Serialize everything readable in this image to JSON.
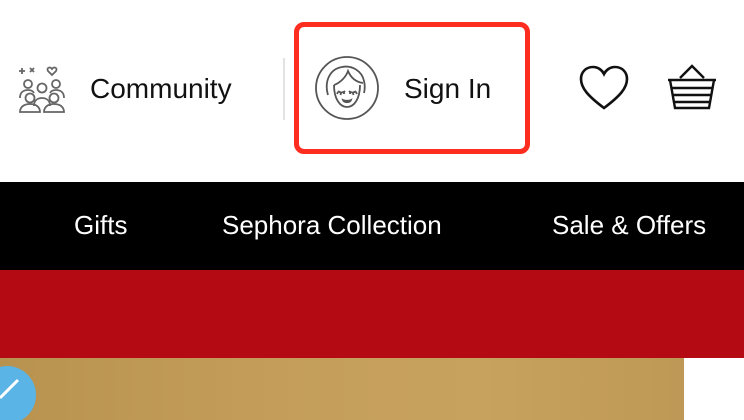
{
  "header": {
    "community": {
      "label": "Community",
      "icon": "community-icon"
    },
    "signin": {
      "label": "Sign In",
      "icon": "avatar-face-icon"
    },
    "loves": {
      "icon": "heart-icon"
    },
    "basket": {
      "icon": "basket-icon"
    },
    "highlight_color": "#ff2d1f"
  },
  "nav": {
    "items": [
      {
        "label": "Gifts"
      },
      {
        "label": "Sephora Collection"
      },
      {
        "label": "Sale & Offers"
      }
    ],
    "background": "#000000"
  },
  "promo": {
    "background": "#b40a14"
  },
  "hero": {
    "background": "#c49d5a"
  }
}
